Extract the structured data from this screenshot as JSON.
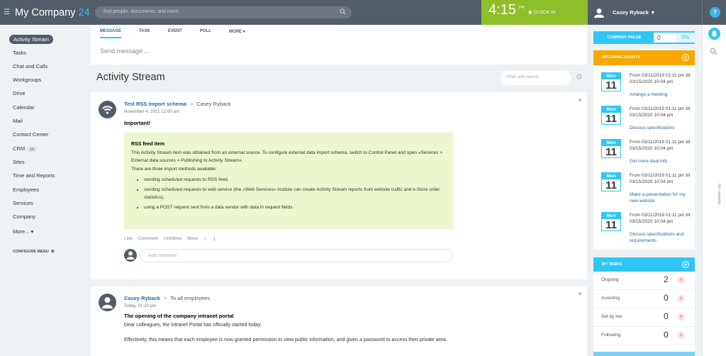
{
  "header": {
    "logo_text": "My Company",
    "logo_number": "24",
    "search_placeholder": "find people, documents, and more",
    "clock_time": "4:15",
    "clock_ampm": "PM",
    "clock_in_label": "CLOCK IN",
    "user_name": "Casey Ryback",
    "help_label": "?"
  },
  "sidebar": {
    "items": [
      {
        "label": "Activity Stream"
      },
      {
        "label": "Tasks"
      },
      {
        "label": "Chat and Calls"
      },
      {
        "label": "Workgroups"
      },
      {
        "label": "Drive"
      },
      {
        "label": "Calendar"
      },
      {
        "label": "Mail"
      },
      {
        "label": "Contact Center"
      },
      {
        "label": "CRM",
        "badge": "16"
      },
      {
        "label": "Sites"
      },
      {
        "label": "Time and Reports"
      },
      {
        "label": "Employees"
      },
      {
        "label": "Services"
      },
      {
        "label": "Company"
      },
      {
        "label": "More..."
      }
    ],
    "configure_label": "CONFIGURE MENU"
  },
  "composer": {
    "tabs": [
      "MESSAGE",
      "TASK",
      "EVENT",
      "POLL",
      "MORE"
    ],
    "placeholder": "Send message ..."
  },
  "stream": {
    "title": "Activity Stream",
    "filter_placeholder": "Filter and search"
  },
  "posts": [
    {
      "title": "Test RSS import schema",
      "destination": "Casey Ryback",
      "date": "November 4, 2011 12:00 am",
      "heading": "Important!",
      "rss_title": "RSS feed item",
      "rss_text": "This Activity Stream item was obtained from an external source. To configure external data import schema, switch to Control Panel and open «Services > External data sources > Publishing to Activity Stream».",
      "rss_intro": "There are three import methods available:",
      "rss_items": [
        "sending scheduled requests to RSS feed,",
        "sending scheduled requests to web service (the «Web Services» module can create Activity Stream reports from website traffic and e-Store order statistics),",
        "using a POST request sent from a data vendor with data in request fields."
      ],
      "actions": [
        "Like",
        "Comment",
        "Unfollow",
        "More"
      ],
      "views": "1",
      "comment_placeholder": "Add comment"
    },
    {
      "title": "Casey Ryback",
      "destination": "To all employees",
      "date": "Today, 01:10 pm",
      "heading": "The opening of the company intranet portal",
      "line1": "Dear colleagues, the Intranet Portal has officially started today.",
      "line2": "Effectively, this means that each employee is now granted permission to view public information, and given a password to access their private area."
    }
  ],
  "pulse": {
    "label": "COMPANY PULSE",
    "value": "0",
    "percent": "0%"
  },
  "events": {
    "header": "UPCOMING EVENTS",
    "items": [
      {
        "month": "Mon",
        "day": "11",
        "time": "From 03/11/2019 01:11 pm till 03/15/2020 10:04 pm",
        "name": "Arrange a meeting"
      },
      {
        "month": "Mon",
        "day": "11",
        "time": "From 03/11/2019 01:11 pm till 03/15/2020 10:04 pm",
        "name": "Discuss specifications"
      },
      {
        "month": "Mon",
        "day": "11",
        "time": "From 03/11/2019 01:11 pm till 03/15/2020 10:04 pm",
        "name": "Get more deal info"
      },
      {
        "month": "Mon",
        "day": "11",
        "time": "From 03/11/2019 01:11 pm till 03/15/2020 10:04 pm",
        "name": "Make a presentation for my new website"
      },
      {
        "month": "Mon",
        "day": "11",
        "time": "From 03/11/2019 01:11 pm till 03/15/2020 10:04 pm",
        "name": "Discuss specifications and requirements"
      }
    ]
  },
  "tasks": {
    "header": "MY TASKS",
    "rows": [
      {
        "label": "Ongoing",
        "count": "2",
        "badge": "0"
      },
      {
        "label": "Assisting",
        "count": "0",
        "badge": "0"
      },
      {
        "label": "Set by me",
        "count": "0",
        "badge": "0"
      },
      {
        "label": "Following",
        "count": "0",
        "badge": "0"
      }
    ]
  },
  "contacts": {
    "empty_label": "- No contacts -"
  }
}
